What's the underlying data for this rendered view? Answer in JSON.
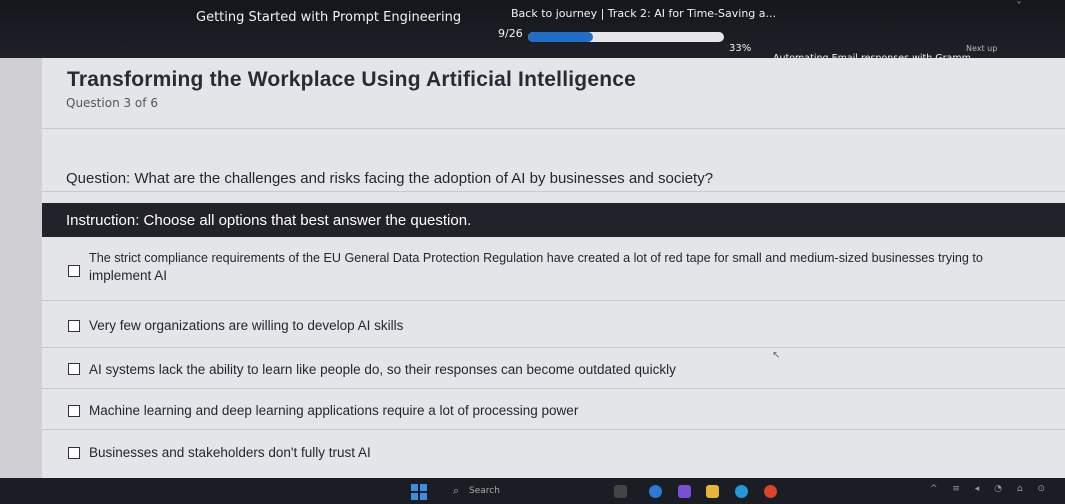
{
  "header": {
    "course_title": "Getting Started with Prompt Engineering",
    "back_link": "Back to journey  |  Track 2: AI for Time-Saving a...",
    "progress_count": "9/26",
    "progress_fraction": 0.33,
    "progress_percent": "33%",
    "next_up_label": "Next up",
    "next_title": "Automating Email responses with Grammarly AI co...",
    "next_icon": "skip-next-icon"
  },
  "main": {
    "title": "Transforming the Workplace Using Artificial Intelligence",
    "question_count": "Question 3 of 6",
    "question": "Question: What are the challenges and risks facing the adoption of AI by businesses and society?",
    "instruction": "Instruction: Choose all options that best answer the question.",
    "options": [
      {
        "line1": "The strict compliance requirements of the EU General Data Protection Regulation have created a lot of red tape for small and medium-sized businesses trying to",
        "line2": "implement AI"
      },
      {
        "line1": "Very few organizations are willing to develop AI skills"
      },
      {
        "line1": "AI systems lack the ability to learn like people do, so their responses can become outdated quickly"
      },
      {
        "line1": "Machine learning and deep learning applications require a lot of processing power"
      },
      {
        "line1": "Businesses and stakeholders don't fully trust AI"
      }
    ]
  },
  "taskbar": {
    "search_placeholder": "Search",
    "colors": {
      "accent": "#1f6fc8",
      "dark": "#1b1d25"
    }
  }
}
